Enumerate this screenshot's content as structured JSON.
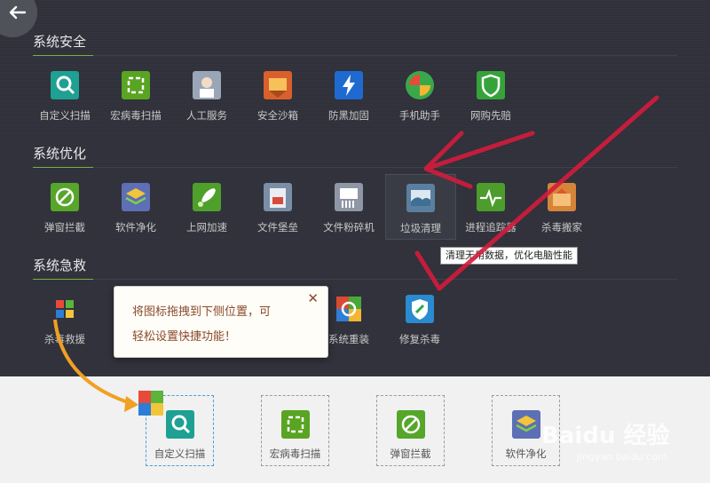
{
  "sections": [
    {
      "title": "系统安全",
      "tools": [
        {
          "label": "自定义扫描",
          "icon": "magnifier-icon",
          "color": "#1ea092"
        },
        {
          "label": "宏病毒扫描",
          "icon": "scan-icon",
          "color": "#5aa423"
        },
        {
          "label": "人工服务",
          "icon": "doctor-icon",
          "color": "#9aa6b8"
        },
        {
          "label": "安全沙箱",
          "icon": "sandbox-icon",
          "color": "#d9602c"
        },
        {
          "label": "防黑加固",
          "icon": "lightning-icon",
          "color": "#1f6ad0"
        },
        {
          "label": "手机助手",
          "icon": "phone-ball-icon",
          "color": "#3aa84a"
        },
        {
          "label": "网购先赔",
          "icon": "shield-icon",
          "color": "#35a33a"
        }
      ]
    },
    {
      "title": "系统优化",
      "tools": [
        {
          "label": "弹窗拦截",
          "icon": "block-popup-icon",
          "color": "#56a62a"
        },
        {
          "label": "软件净化",
          "icon": "layers-icon",
          "color": "#5d6fb5"
        },
        {
          "label": "上网加速",
          "icon": "rocket-icon",
          "color": "#4ea02a"
        },
        {
          "label": "文件堡垒",
          "icon": "file-vault-icon",
          "color": "#7a8ea6"
        },
        {
          "label": "文件粉碎机",
          "icon": "shredder-icon",
          "color": "#8f97a6"
        },
        {
          "label": "垃圾清理",
          "icon": "cleanup-icon",
          "color": "#5a7fa0"
        },
        {
          "label": "进程追踪器",
          "icon": "pulse-icon",
          "color": "#4c9d2b"
        },
        {
          "label": "杀毒搬家",
          "icon": "move-icon",
          "color": "#d5843a"
        }
      ]
    },
    {
      "title": "系统急救",
      "tools": [
        {
          "label": "杀毒救援",
          "icon": "windows-icon",
          "color": "#2e7dd6"
        },
        {
          "label": "系统重装",
          "icon": "reinstall-icon",
          "color": "#d94a33"
        },
        {
          "label": "修复杀毒",
          "icon": "repair-icon",
          "color": "#2a8bd0"
        }
      ]
    }
  ],
  "tooltip": "清理无用数据，优化电脑性能",
  "popup": {
    "line1": "将图标拖拽到下侧位置，可",
    "line2": "轻松设置快捷功能！",
    "close": "✕"
  },
  "shortcuts": [
    {
      "label": "自定义扫描",
      "icon": "magnifier-icon",
      "color": "#1ea092"
    },
    {
      "label": "宏病毒扫描",
      "icon": "scan-icon",
      "color": "#5aa423"
    },
    {
      "label": "弹窗拦截",
      "icon": "block-popup-icon",
      "color": "#56a62a"
    },
    {
      "label": "软件净化",
      "icon": "layers-icon",
      "color": "#5d6fb5"
    }
  ],
  "watermark": {
    "brand": "Baidu 经验",
    "url": "jingyan.baidu.com"
  },
  "accent": "#6fb446"
}
